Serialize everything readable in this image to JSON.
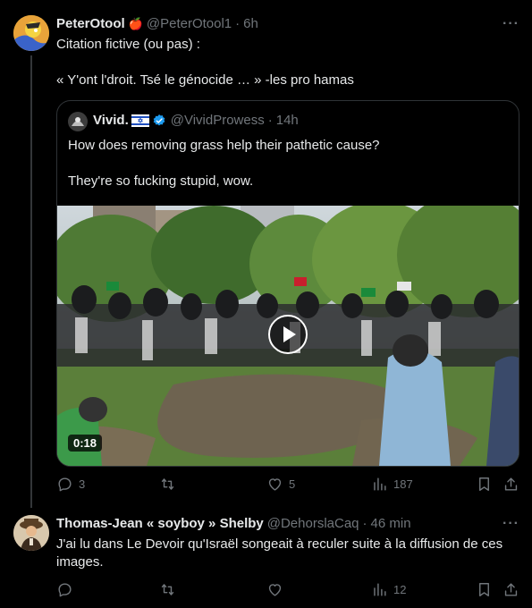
{
  "tweet1": {
    "name": "PeterOtool",
    "name_emoji": "🍎",
    "handle": "@PeterOtool1",
    "time": "6h",
    "line1": "Citation fictive (ou pas) :",
    "line2": "« Y'ont l'droit. Tsé le génocide … » -les pro hamas",
    "quote": {
      "name": "Vivid.",
      "flag": "israel-flag-icon",
      "handle": "@VividProwess",
      "time": "14h",
      "line1": "How does removing grass help their pathetic cause?",
      "line2": "They're so fucking stupid, wow.",
      "video_duration": "0:18"
    },
    "replies": "3",
    "retweets": "",
    "likes": "5",
    "views": "187"
  },
  "tweet2": {
    "name": "Thomas-Jean « soyboy » Shelby",
    "handle": "@DehorslaCaq",
    "time": "46 min",
    "text": "J'ai lu dans Le Devoir qu'Israël songeait à reculer suite à la diffusion de ces images.",
    "replies": "",
    "retweets": "",
    "likes": "",
    "views": "12"
  },
  "separator": "·",
  "more_label": "···",
  "colors": {
    "background": "#000000",
    "text": "#e7e9ea",
    "muted": "#71767b",
    "border": "#2f3336",
    "verified": "#1d9bf0"
  }
}
